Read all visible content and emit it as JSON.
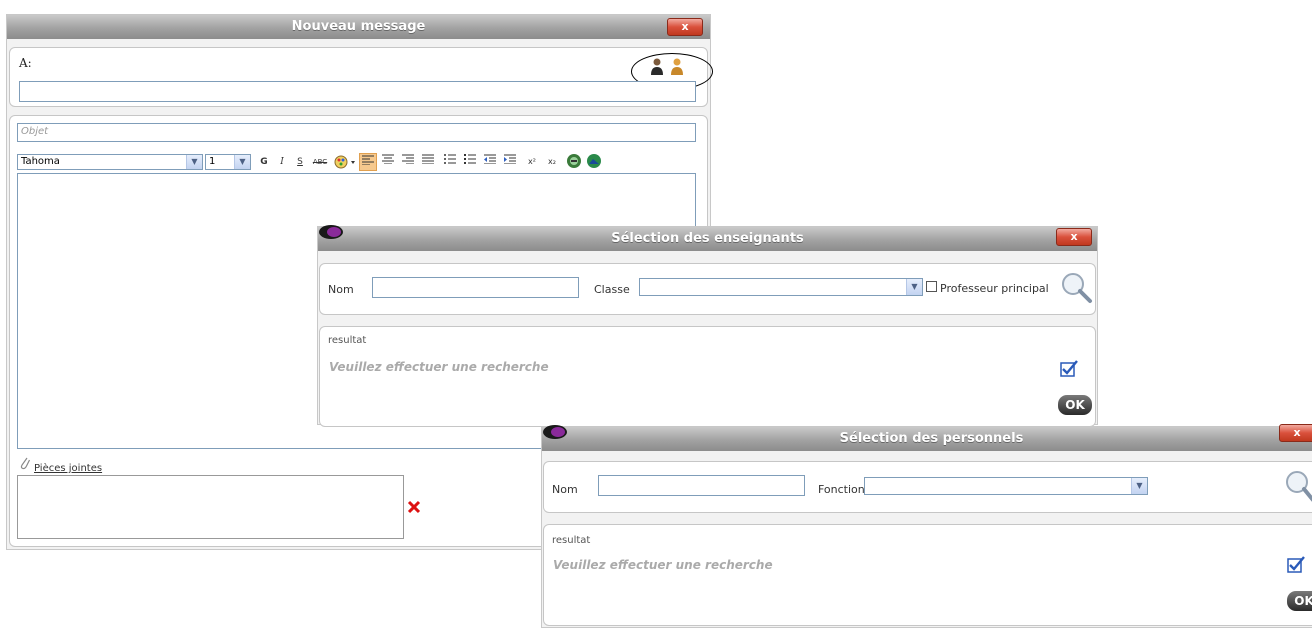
{
  "compose": {
    "title": "Nouveau message",
    "close_label": "x",
    "to_label": "A:",
    "to_value": "",
    "subject_placeholder": "Objet",
    "font_name": "Tahoma",
    "font_size": "1",
    "toolbar": {
      "bold": "G",
      "italic": "I",
      "underline": "S",
      "strike": "ABC",
      "superscript": "x²",
      "subscript": "x₂"
    },
    "attachments_label": "Pièces jointes"
  },
  "teachers_dialog": {
    "title": "Sélection des enseignants",
    "close_label": "x",
    "name_label": "Nom",
    "name_value": "",
    "class_label": "Classe",
    "class_value": "",
    "principal_label": "Professeur principal",
    "result_label": "resultat",
    "result_placeholder": "Veuillez effectuer une recherche",
    "ok_label": "OK"
  },
  "staff_dialog": {
    "title": "Sélection des personnels",
    "close_label": "x",
    "name_label": "Nom",
    "name_value": "",
    "function_label": "Fonction",
    "function_value": "",
    "result_label": "resultat",
    "result_placeholder": "Veuillez effectuer une recherche",
    "ok_label": "OK"
  }
}
